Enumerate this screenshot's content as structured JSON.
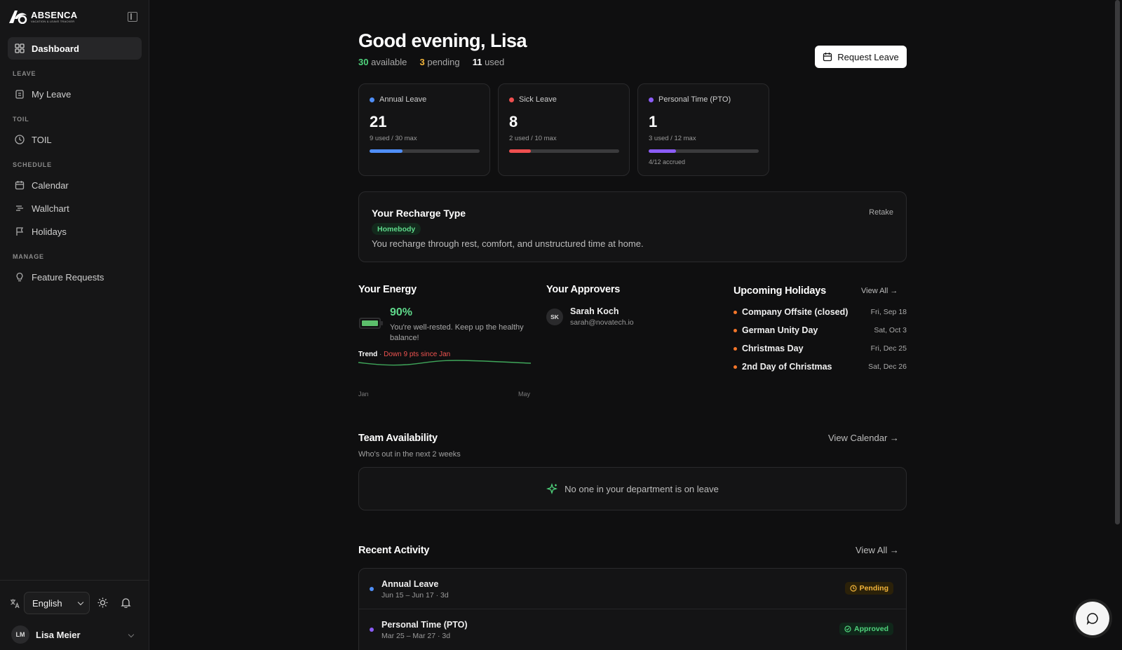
{
  "app": {
    "logo_name": "ABSENCA",
    "logo_tagline": "VACATION & LEAVE TRACKER"
  },
  "sidebar": {
    "items": {
      "dashboard": "Dashboard",
      "my_leave": "My Leave",
      "toil": "TOIL",
      "calendar": "Calendar",
      "wallchart": "Wallchart",
      "holidays": "Holidays",
      "feature_requests": "Feature Requests"
    },
    "sections": {
      "leave": "LEAVE",
      "toil": "TOIL",
      "schedule": "SCHEDULE",
      "manage": "MANAGE"
    },
    "language": "English",
    "user": {
      "initials": "LM",
      "name": "Lisa Meier"
    }
  },
  "header": {
    "greeting": "Good evening, Lisa",
    "summary": {
      "available_count": "30",
      "available_label": "available",
      "pending_count": "3",
      "pending_label": "pending",
      "used_count": "11",
      "used_label": "used"
    },
    "request_button": "Request Leave"
  },
  "leave_cards": [
    {
      "title": "Annual Leave",
      "count": "21",
      "sub": "9 used / 30 max",
      "progress": 0.3,
      "color": "#4f8ef7",
      "extra": ""
    },
    {
      "title": "Sick Leave",
      "count": "8",
      "sub": "2 used / 10 max",
      "progress": 0.2,
      "color": "#ef4f4f",
      "extra": ""
    },
    {
      "title": "Personal Time (PTO)",
      "count": "1",
      "sub": "3 used / 12 max",
      "progress": 0.25,
      "color": "#8b5cf6",
      "extra": "4/12 accrued"
    }
  ],
  "recharge": {
    "title": "Your Recharge Type",
    "retake": "Retake",
    "type": "Homebody",
    "description": "You recharge through rest, comfort, and unstructured time at home."
  },
  "energy": {
    "title": "Your Energy",
    "percent": "90%",
    "level": 0.9,
    "message": "You're well-rested. Keep up the healthy balance!",
    "trend_label": "Trend",
    "trend_sep": "·",
    "trend_value": "Down 9 pts since Jan",
    "axis_start": "Jan",
    "axis_end": "May"
  },
  "approvers": {
    "title": "Your Approvers",
    "list": [
      {
        "initials": "SK",
        "name": "Sarah Koch",
        "email": "sarah@novatech.io"
      }
    ]
  },
  "holidays": {
    "title": "Upcoming Holidays",
    "view_all": "View All →",
    "list": [
      {
        "name": "Company Offsite (closed)",
        "date": "Fri, Sep 18"
      },
      {
        "name": "German Unity Day",
        "date": "Sat, Oct 3"
      },
      {
        "name": "Christmas Day",
        "date": "Fri, Dec 25"
      },
      {
        "name": "2nd Day of Christmas",
        "date": "Sat, Dec 26"
      }
    ]
  },
  "team": {
    "title": "Team Availability",
    "subtitle": "Who's out in the next 2 weeks",
    "view_calendar": "View Calendar →",
    "empty": "No one in your department is on leave"
  },
  "activity": {
    "title": "Recent Activity",
    "view_all": "View All →",
    "items": [
      {
        "title": "Annual Leave",
        "sub": "Jun 15 – Jun 17 · 3d",
        "status": "Pending",
        "color": "#4f8ef7"
      },
      {
        "title": "Personal Time (PTO)",
        "sub": "Mar 25 – Mar 27 · 3d",
        "status": "Approved",
        "color": "#8b5cf6"
      }
    ]
  }
}
